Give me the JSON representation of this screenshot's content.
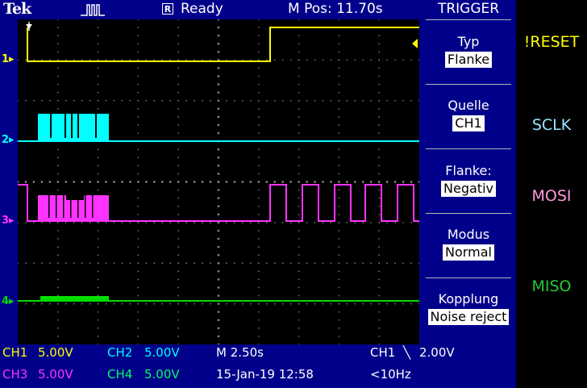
{
  "header": {
    "brand": "Tek",
    "acq_icon": "pulse-train-icon",
    "state_box": "R",
    "state": "Ready",
    "mpos": "M Pos: 11.70s"
  },
  "menu": {
    "title": "TRIGGER",
    "items": [
      {
        "label": "Typ",
        "value": "Flanke"
      },
      {
        "label": "Quelle",
        "value": "CH1"
      },
      {
        "label": "Flanke:",
        "value": "Negativ"
      },
      {
        "label": "Modus",
        "value": "Normal"
      },
      {
        "label": "Kopplung",
        "value": "Noise reject"
      }
    ]
  },
  "channels": [
    {
      "id": "1",
      "color": "#ffff00"
    },
    {
      "id": "2",
      "color": "#00ffff"
    },
    {
      "id": "3",
      "color": "#ff33ff"
    },
    {
      "id": "4",
      "color": "#00dd00"
    }
  ],
  "status": {
    "ch1": "CH1",
    "ch1_scale": "5.00V",
    "ch2": "CH2",
    "ch2_scale": "5.00V",
    "ch3": "CH3",
    "ch3_scale": "5.00V",
    "ch4": "CH4",
    "ch4_scale": "5.00V",
    "timebase": "M 2.50s",
    "date": "15-Jan-19 12:58",
    "trigger_src": "CH1",
    "trigger_symbol": "╲",
    "trigger_level": "2.00V",
    "trigger_freq": "<10Hz"
  },
  "signals": [
    {
      "name": "!RESET",
      "color": "#ffff00"
    },
    {
      "name": "SCLK",
      "color": "#99e6ff"
    },
    {
      "name": "MOSI",
      "color": "#ff99dd"
    },
    {
      "name": "MISO",
      "color": "#22cc33"
    }
  ]
}
